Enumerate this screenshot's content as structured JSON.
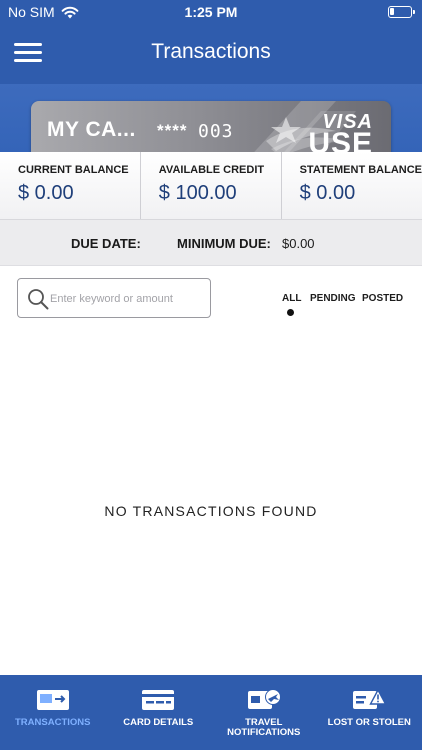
{
  "status_bar": {
    "carrier": "No SIM",
    "time": "1:25 PM"
  },
  "header": {
    "title": "Transactions"
  },
  "card": {
    "name": "MY CA...",
    "masked": "****",
    "last_digits": "003",
    "brand": "VISA",
    "brand_sub": "USE"
  },
  "balances": [
    {
      "label": "CURRENT BALANCE",
      "value": "$ 0.00"
    },
    {
      "label": "AVAILABLE CREDIT",
      "value": "$ 100.00"
    },
    {
      "label": "STATEMENT BALANCE",
      "value": "$ 0.00"
    }
  ],
  "due": {
    "due_date_label": "DUE DATE:",
    "due_date_value": "",
    "minimum_due_label": "MINIMUM DUE:",
    "minimum_due_value": "$0.00"
  },
  "search": {
    "placeholder": "Enter keyword or amount",
    "value": ""
  },
  "filters": {
    "tabs": [
      "ALL",
      "PENDING",
      "POSTED"
    ],
    "selected": "ALL"
  },
  "empty_message": "NO TRANSACTIONS FOUND",
  "bottom_nav": {
    "active": "TRANSACTIONS",
    "items": [
      {
        "label": "TRANSACTIONS",
        "icon": "transactions-icon"
      },
      {
        "label": "CARD DETAILS",
        "icon": "card-details-icon"
      },
      {
        "label_line1": "TRAVEL",
        "label_line2": "NOTIFICATIONS",
        "icon": "travel-notifications-icon"
      },
      {
        "label": "LOST OR STOLEN",
        "icon": "lost-stolen-icon"
      }
    ]
  },
  "colors": {
    "brand_blue": "#2f5cad",
    "active_nav": "#7fb0ff",
    "balance_value": "#1f3f7a"
  }
}
